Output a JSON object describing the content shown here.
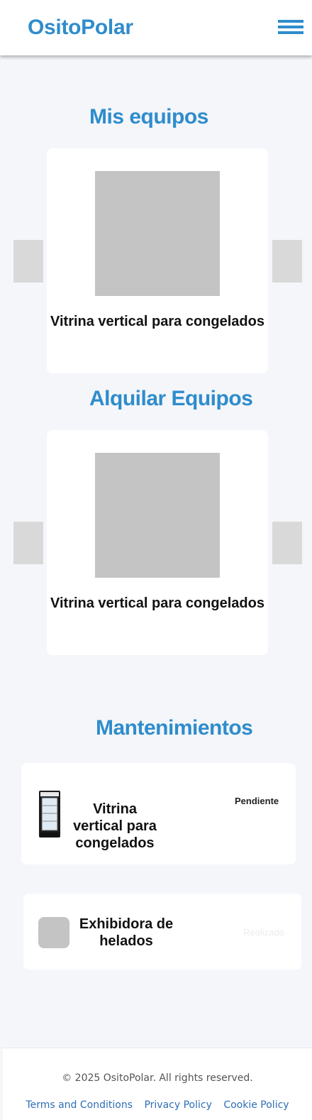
{
  "header": {
    "brand": "OsitoPolar",
    "menu_icon": "hamburger-menu-icon"
  },
  "my_equipment": {
    "title": "Mis equipos",
    "item_name": "Vitrina vertical para congelados"
  },
  "rent_equipment": {
    "title": "Alquilar Equipos",
    "item_name": "Vitrina vertical para congelados"
  },
  "maintenance": {
    "title": "Mantenimientos",
    "items": [
      {
        "name": "Vitrina vertical para congelados",
        "status": "Pendiente",
        "image_icon": "freezer-display-icon"
      },
      {
        "name": "Exhibidora de helados",
        "status": "Realizado",
        "image_icon": "image-placeholder-icon"
      }
    ]
  },
  "footer": {
    "copyright": "© 2025 OsitoPolar. All rights reserved.",
    "links": [
      "Terms and Conditions",
      "Privacy Policy",
      "Cookie Policy"
    ]
  },
  "colors": {
    "accent": "#2e8ccc",
    "background": "#f4f6fa",
    "placeholder": "#c4c4c4"
  }
}
